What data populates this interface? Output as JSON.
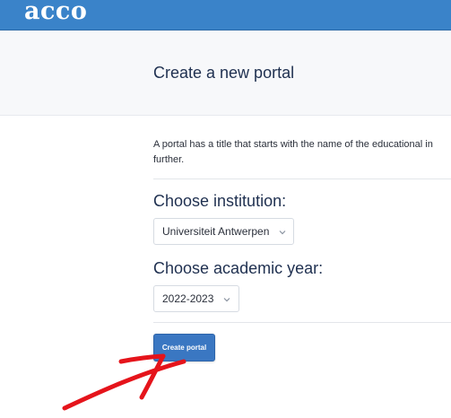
{
  "app": {
    "logo_text": "acco",
    "brand_color": "#3a83c9"
  },
  "page": {
    "title": "Create a new portal"
  },
  "intro": {
    "line1": "A portal has a title that starts with the name of the educational in",
    "line2": "further."
  },
  "institution": {
    "heading": "Choose institution:",
    "selected": "Universiteit Antwerpen",
    "icon": "chevron-down-icon"
  },
  "academic_year": {
    "heading": "Choose academic year:",
    "selected": "2022-2023",
    "icon": "chevron-down-icon"
  },
  "actions": {
    "create_label": "Create portal",
    "button_color": "#3a77c2"
  },
  "annotation": {
    "color": "#e5141b",
    "icon": "hand-drawn-arrow"
  }
}
